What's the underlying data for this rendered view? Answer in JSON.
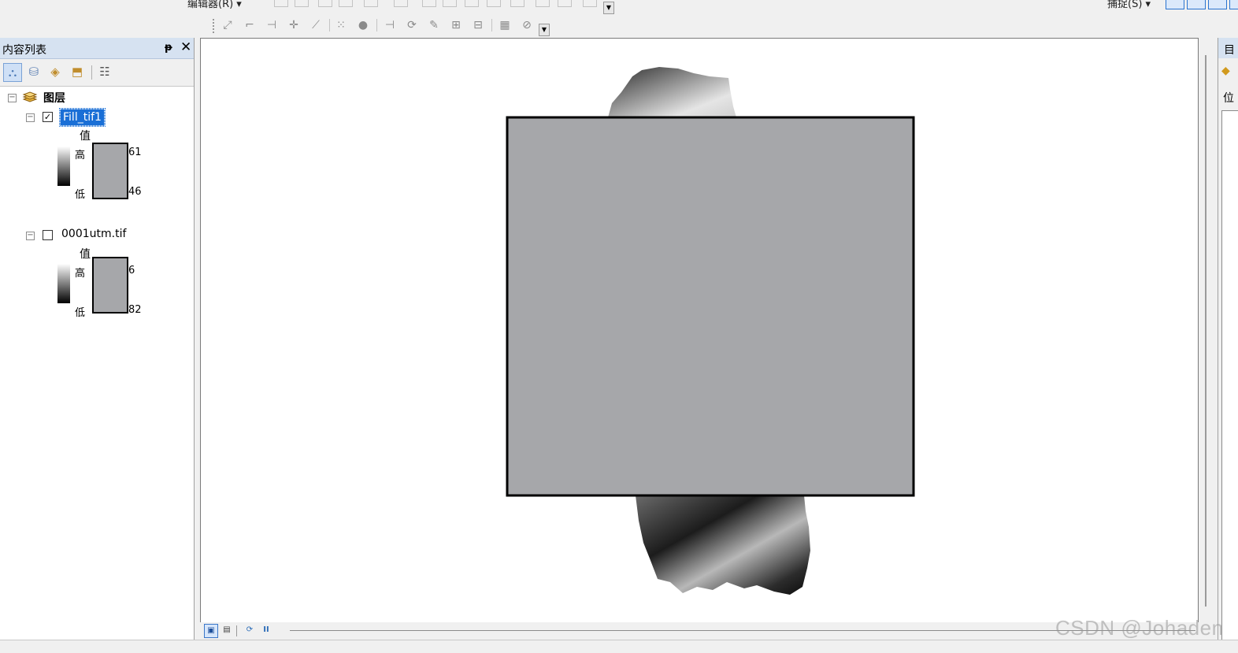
{
  "toolbar_top": {
    "editor_label": "编辑器(R) ▾",
    "snap_label": "捕捉(S) ▾"
  },
  "toc": {
    "title": "内容列表",
    "pin_glyph": "ᵽ",
    "close_glyph": "✕",
    "root": {
      "label": "图层",
      "expand_glyph": "⊟"
    },
    "layers": [
      {
        "name": "Fill_tif1",
        "checked": true,
        "selected": true,
        "legend": {
          "heading": "值",
          "high_label": "高",
          "low_label": "低",
          "high_value": "61",
          "low_value": "46"
        }
      },
      {
        "name": "0001utm.tif",
        "checked": false,
        "selected": false,
        "legend": {
          "heading": "值",
          "high_label": "高",
          "low_label": "低",
          "high_value": "6",
          "low_value": "82"
        }
      }
    ]
  },
  "catalog": {
    "title": "目",
    "location_label": "位"
  },
  "map": {
    "overlay_color": "#a6a7aa",
    "overlay_border": "#000000"
  },
  "check_glyphs": {
    "checked": "✓",
    "unchecked": ""
  },
  "icons": {
    "pause": "II",
    "refresh": "⟳",
    "layout": "▣",
    "page": "▤"
  },
  "watermark": "CSDN @Johaden"
}
